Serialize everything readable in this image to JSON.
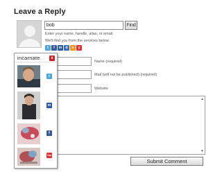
{
  "page": {
    "title": "Leave a Reply"
  },
  "identity": {
    "search_value": "bob",
    "find_label": "Find",
    "hint_line1": "Enter your name, handle, alias, or email.",
    "hint_line2": "We'll find you from the services below."
  },
  "services": [
    "twitter",
    "facebook",
    "myspace",
    "delicious",
    "openid",
    "youtube"
  ],
  "popup": {
    "brand": "incarnate",
    "close_label": "x",
    "results": [
      {
        "service": "twitter",
        "badge_color": "#4fa9d8",
        "badge_text": "t"
      },
      {
        "service": "myspace",
        "badge_color": "#2a5aa6",
        "badge_text": "m"
      },
      {
        "service": "facebook",
        "badge_color": "#3b5998",
        "badge_text": "f"
      },
      {
        "service": "youtube",
        "badge_color": "#d33",
        "badge_text": "You"
      }
    ]
  },
  "form": {
    "name_label": "Name (required)",
    "mail_label": "Mail (will not be published) (required)",
    "website_label": "Website",
    "submit_label": "Submit Comment"
  },
  "colors": {
    "button_border": "#7a7a7a",
    "field_border": "#a0a0a0",
    "close_red": "#cc2020"
  }
}
